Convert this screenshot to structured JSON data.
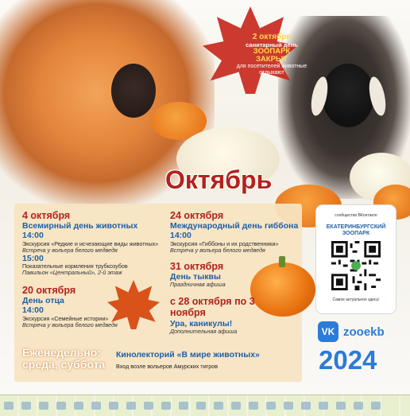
{
  "closed_notice": {
    "date": "2 октября",
    "day_type": "санитарный день",
    "line1": "ЗООПАРК",
    "line2": "ЗАКРЫТ",
    "reason": "для посетителей животные отдыхают"
  },
  "month": "Октябрь",
  "events": [
    {
      "date": "4 октября",
      "name": "Всемирный день животных",
      "time": "14:00",
      "desc": "Экскурсия «Редкие и исчезающие виды животных»",
      "note": "Встреча у вольера белого медведя",
      "time2": "15:00",
      "desc2": "Показательные кормления трубкозубов",
      "note2": "Павильон «Центральный», 2-й этаж"
    },
    {
      "date": "20 октября",
      "name": "День отца",
      "time": "14:00",
      "desc": "Экскурсия «Семейные истории»",
      "note": "Встреча у вольера белого медведя"
    },
    {
      "date": "24 октября",
      "name": "Международный день гиббона",
      "time": "14:00",
      "desc": "Экскурсия «Гиббоны и их родственники»",
      "note": "Встреча у вольера белого медведя"
    },
    {
      "date": "31 октября",
      "name": "День тыквы",
      "note": "Праздничная афиша"
    },
    {
      "date": "с 28 октября по 3 ноября",
      "name": "Ура, каникулы!",
      "note": "Дополнительная афиша"
    }
  ],
  "weekly": {
    "label": "Еженедельно:",
    "days": "среда, суббота",
    "event": "Кинолекторий «В мире животных»",
    "location": "Вход возле вольеров Амурских тигров"
  },
  "qr": {
    "top": "сообщество ВКонтакте",
    "name": "ЕКАТЕРИНБУРГСКИЙ ЗООПАРК",
    "bottom": "Самое актуальное здесь!"
  },
  "vk": {
    "logo": "VK",
    "handle": "zooekb"
  },
  "year": "2024",
  "colors": {
    "accent_red": "#b3221d",
    "accent_blue": "#1f5fa8",
    "vk_blue": "#2b7bd8",
    "panel": "#f6e3c1"
  }
}
